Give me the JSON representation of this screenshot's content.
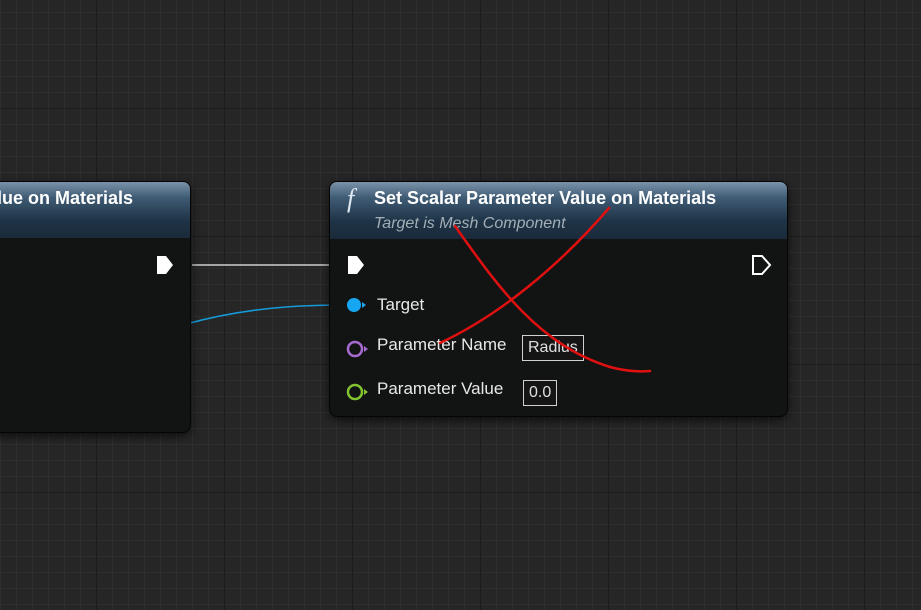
{
  "left_node": {
    "title": "lue on Materials"
  },
  "main_node": {
    "icon": "function-icon",
    "icon_glyph": "f",
    "title": "Set Scalar Parameter Value on Materials",
    "subtitle": "Target is Mesh Component",
    "pins": {
      "target": {
        "label": "Target",
        "color": "#16a6f2"
      },
      "parameter_name": {
        "label": "Parameter Name",
        "value": "Radius",
        "color": "#a76bd1"
      },
      "parameter_value": {
        "label": "Parameter Value",
        "value": "0.0",
        "color": "#82c430"
      }
    }
  },
  "colors": {
    "exec_wire": "#cfcfcf",
    "object_wire": "#169ad8",
    "annotation_strike": "#e01010"
  }
}
